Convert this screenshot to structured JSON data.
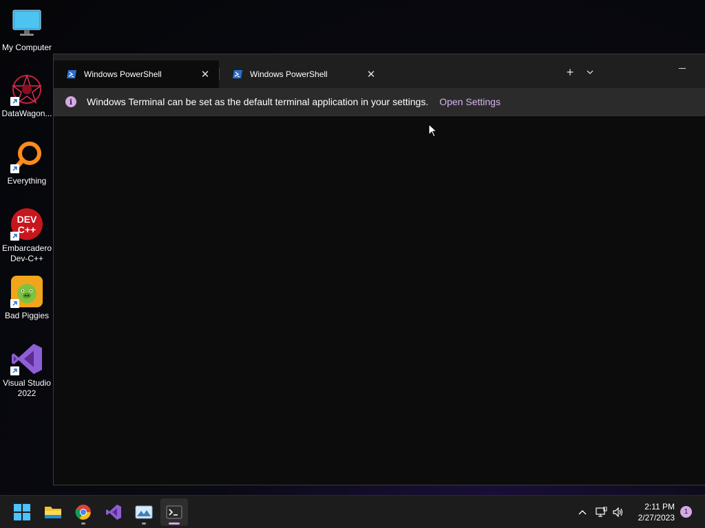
{
  "desktop": {
    "icons": [
      {
        "label": "My Computer",
        "icon": "monitor-icon"
      },
      {
        "label": "DataWagon...",
        "icon": "datawagon-icon"
      },
      {
        "label": "Everything",
        "icon": "magnifier-icon"
      },
      {
        "label": "Embarcadero Dev-C++",
        "icon": "devcpp-icon",
        "badge": "DEV\nC++"
      },
      {
        "label": "Bad Piggies",
        "icon": "bad-piggies-icon"
      },
      {
        "label": "Visual Studio 2022",
        "icon": "visual-studio-icon"
      }
    ]
  },
  "terminal": {
    "tabs": [
      {
        "title": "Windows PowerShell",
        "icon": "powershell-icon",
        "active": true
      },
      {
        "title": "Windows PowerShell",
        "icon": "powershell-icon",
        "active": false
      }
    ],
    "new_tab": "+",
    "dropdown": "⌄",
    "info": {
      "icon": "i",
      "message": "Windows Terminal can be set as the default terminal application in your settings.",
      "link": "Open Settings"
    }
  },
  "taskbar": {
    "apps": [
      "start-icon",
      "file-explorer-icon",
      "chrome-icon",
      "visual-studio-icon",
      "image-viewer-icon",
      "terminal-icon"
    ],
    "clock": {
      "time": "2:11 PM",
      "date": "2/27/2023"
    },
    "notifications": "1"
  },
  "colors": {
    "accent": "#d6a8e8",
    "terminal_bg": "#0c0c0c",
    "titlebar_bg": "#1f1f1f",
    "infobar_bg": "#2b2b2b"
  }
}
